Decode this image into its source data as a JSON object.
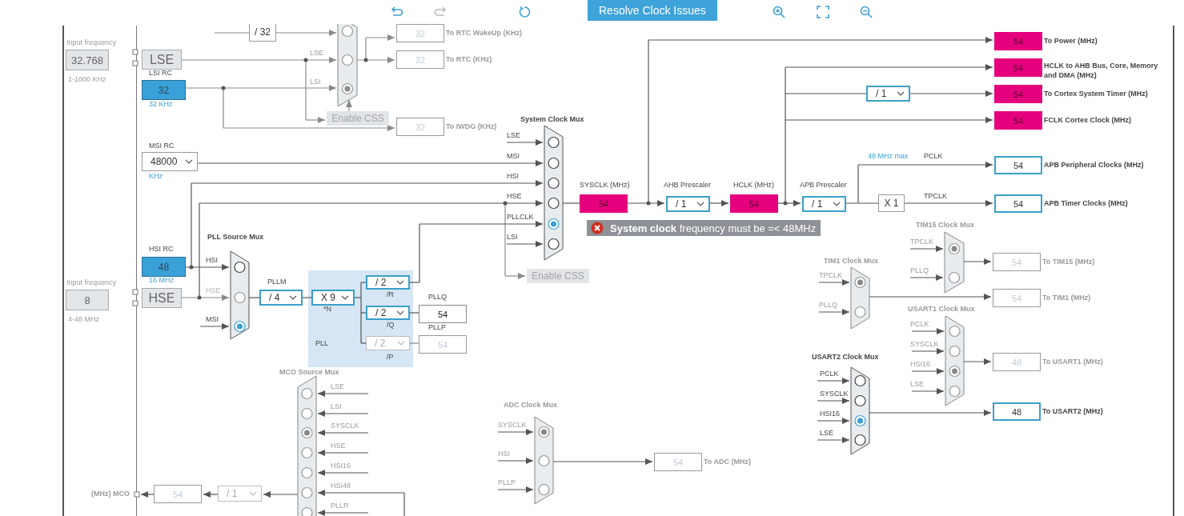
{
  "toolbar": {
    "buttons": [
      {
        "kind": "undo",
        "disabled": false
      },
      {
        "kind": "redo",
        "disabled": true
      },
      {
        "kind": "reset",
        "disabled": false
      },
      {
        "kind": "resolve",
        "label": "Resolve Clock Issues"
      },
      {
        "kind": "zoom-in",
        "disabled": false
      },
      {
        "kind": "fit",
        "disabled": false
      },
      {
        "kind": "zoom-out",
        "disabled": false
      }
    ]
  },
  "frequency_inputs": [
    {
      "label": "Input frequency",
      "value": "32.768",
      "range": "1-1000 KHz",
      "disabled": true
    },
    {
      "label": "Input frequency",
      "value": "8",
      "range": "4-48 MHz",
      "disabled": true
    }
  ],
  "sources": [
    {
      "kind": "crystal",
      "name": "LSE"
    },
    {
      "kind": "rc",
      "name": "LSI RC",
      "value": "32",
      "unit": "32 KHz"
    },
    {
      "kind": "select",
      "name": "MSI RC",
      "value": "48000",
      "unit": "KHz"
    },
    {
      "kind": "rc",
      "name": "HSI RC",
      "value": "48",
      "unit": "16 MHz"
    },
    {
      "kind": "crystal",
      "name": "HSE"
    }
  ],
  "muxes": [
    {
      "enabled": false,
      "inputs": [
        {
          "selected": false
        },
        {
          "label": "LSE",
          "selected": false
        },
        {
          "label": "LSI",
          "selected": true
        }
      ]
    },
    {
      "title": "System Clock Mux",
      "enabled": true,
      "inputs": [
        {
          "label": "LSE",
          "selected": false
        },
        {
          "label": "MSI",
          "selected": false
        },
        {
          "label": "HSI",
          "selected": false
        },
        {
          "label": "HSE",
          "selected": false
        },
        {
          "label": "PLLCLK",
          "selected": true
        },
        {
          "label": "LSI",
          "selected": false
        }
      ]
    },
    {
      "title": "PLL Source Mux",
      "enabled": true,
      "inputs": [
        {
          "label": "HSI",
          "selected": false,
          "disabled": false
        },
        {
          "label": "HSE",
          "selected": false,
          "disabled": true
        },
        {
          "label": "MSI",
          "selected": true,
          "disabled": false
        }
      ]
    },
    {
      "title": "MCO Source Mux",
      "enabled": false,
      "inputs": [
        {
          "label": "LSE",
          "selected": false
        },
        {
          "label": "LSI",
          "selected": false
        },
        {
          "label": "SYSCLK",
          "selected": true
        },
        {
          "label": "HSE",
          "selected": false
        },
        {
          "label": "HSI16",
          "selected": false
        },
        {
          "label": "HSI48",
          "selected": false
        },
        {
          "label": "PLLR",
          "selected": false
        }
      ]
    },
    {
      "title": "ADC Clock Mux",
      "enabled": false,
      "inputs": [
        {
          "label": "SYSCLK",
          "selected": true
        },
        {
          "label": "HSI",
          "selected": false
        },
        {
          "label": "PLLP",
          "selected": false
        }
      ]
    },
    {
      "title": "TIM15 Clock Mux",
      "enabled": false,
      "inputs": [
        {
          "label": "TPCLK",
          "selected": true
        },
        {
          "label": "PLLQ",
          "selected": false
        }
      ]
    },
    {
      "title": "TIM1 Clock Mux",
      "enabled": false,
      "inputs": [
        {
          "label": "TPCLK",
          "selected": true
        },
        {
          "label": "PLLQ",
          "selected": false
        }
      ]
    },
    {
      "title": "USART1 Clock Mux",
      "enabled": false,
      "inputs": [
        {
          "label": "PCLK",
          "selected": false
        },
        {
          "label": "SYSCLK",
          "selected": false
        },
        {
          "label": "HSI16",
          "selected": true
        },
        {
          "label": "LSE",
          "selected": false
        }
      ]
    },
    {
      "title": "USART2 Clock Mux",
      "enabled": true,
      "inputs": [
        {
          "label": "PCLK",
          "selected": false
        },
        {
          "label": "SYSCLK",
          "selected": false
        },
        {
          "label": "HSI16",
          "selected": true
        },
        {
          "label": "LSE",
          "selected": false
        }
      ]
    }
  ],
  "dividers": [
    {
      "kind": "fixed",
      "value": "/ 32"
    },
    {
      "kind": "select",
      "label": "PLLM",
      "value": "/ 4",
      "disabled": false
    },
    {
      "kind": "select",
      "value": "X 9",
      "caption": "*N",
      "disabled": false
    },
    {
      "kind": "select",
      "value": "/ 2",
      "caption": "/R",
      "disabled": false
    },
    {
      "kind": "select",
      "value": "/ 2",
      "caption": "/Q",
      "disabled": false
    },
    {
      "kind": "select",
      "value": "/ 2",
      "caption": "/P",
      "disabled": true
    },
    {
      "kind": "select",
      "label": "AHB Prescaler",
      "value": "/ 1",
      "disabled": false
    },
    {
      "kind": "select",
      "label": "APB Prescaler",
      "value": "/ 1",
      "disabled": false
    },
    {
      "kind": "select",
      "value": "/ 1",
      "disabled": false
    },
    {
      "kind": "fixed",
      "value": "X 1"
    },
    {
      "kind": "select",
      "value": "/ 1",
      "disabled": true
    }
  ],
  "rtc_outputs": [
    {
      "kind": "disabled",
      "value": "32",
      "label": "To RTC WakeUp (KHz)"
    },
    {
      "kind": "disabled",
      "value": "32",
      "label": "To RTC (KHz)"
    },
    {
      "kind": "disabled",
      "value": "32",
      "label": "To IWDG (KHz)"
    }
  ],
  "bus_outputs": [
    {
      "kind": "error",
      "value": "54",
      "label": "To Power (MHz)"
    },
    {
      "kind": "error",
      "value": "54",
      "label": "HCLK to AHB Bus, Core, Memory and DMA (MHz)"
    },
    {
      "kind": "error",
      "value": "54",
      "label": "To Cortex System Timer (MHz)"
    },
    {
      "kind": "error",
      "value": "54",
      "label": "FCLK Cortex Clock (MHz)"
    },
    {
      "kind": "active",
      "value": "54",
      "label": "APB Peripheral Clocks (MHz)"
    },
    {
      "kind": "error",
      "value": "54",
      "label": "SYSCLK (MHz)"
    },
    {
      "kind": "error",
      "value": "54",
      "label": "HCLK (MHz)"
    },
    {
      "kind": "active",
      "value": "54",
      "label": "APB Timer Clocks (MHz)"
    }
  ],
  "pll_outputs": [
    {
      "kind": "plain",
      "value": "54",
      "label": "PLLQ"
    },
    {
      "kind": "disabled",
      "value": "54",
      "label": "PLLP"
    }
  ],
  "peripheral_outputs": [
    {
      "kind": "disabled",
      "value": "54",
      "label": "To TIM15 (MHz)"
    },
    {
      "kind": "disabled",
      "value": "54",
      "label": "To TIM1 (MHz)"
    },
    {
      "kind": "disabled",
      "value": "48",
      "label": "To USART1 (MHz)"
    },
    {
      "kind": "active",
      "value": "48",
      "label": "To USART2 (MHz)"
    },
    {
      "kind": "disabled",
      "value": "54",
      "label": "To ADC (MHz)"
    },
    {
      "kind": "disabled",
      "value": "54",
      "label": "(MHz) MCO"
    }
  ],
  "signal_labels": [
    {
      "kind": "limit",
      "text": "48 MHz max"
    },
    {
      "kind": "signal",
      "text": "PCLK"
    },
    {
      "kind": "signal",
      "text": "TPCLK"
    },
    {
      "kind": "signal",
      "text": "PLL"
    }
  ],
  "css_buttons": [
    {
      "label": "Enable CSS",
      "disabled": true
    },
    {
      "label": "Enable CSS",
      "disabled": true
    }
  ],
  "error": {
    "message": "**System clock** frequency must be =< 48MHz"
  }
}
